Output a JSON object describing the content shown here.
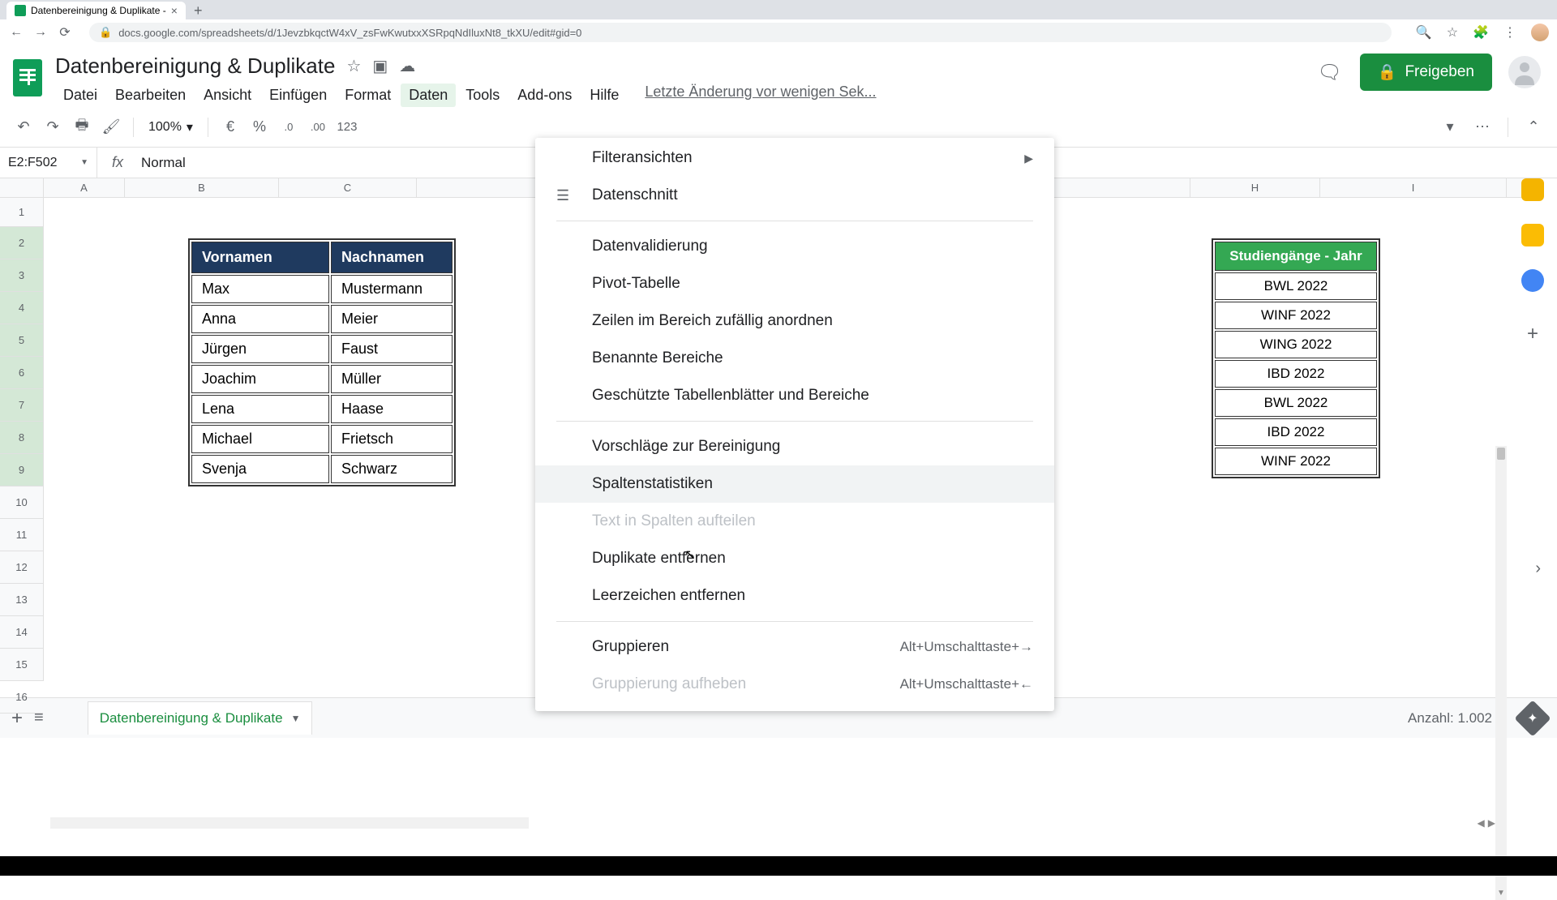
{
  "browser": {
    "tab_title": "Datenbereinigung & Duplikate -",
    "url": "docs.google.com/spreadsheets/d/1JevzbkqctW4xV_zsFwKwutxxXSRpqNdIluxNt8_tkXU/edit#gid=0"
  },
  "doc": {
    "title": "Datenbereinigung & Duplikate",
    "last_edit": "Letzte Änderung vor wenigen Sek..."
  },
  "menu": {
    "file": "Datei",
    "edit": "Bearbeiten",
    "view": "Ansicht",
    "insert": "Einfügen",
    "format": "Format",
    "data": "Daten",
    "tools": "Tools",
    "addons": "Add-ons",
    "help": "Hilfe"
  },
  "toolbar": {
    "zoom": "100%",
    "currency": "€",
    "percent": "%",
    "dec_less": ".0",
    "dec_more": ".00",
    "format123": "123"
  },
  "share_label": "Freigeben",
  "namebox": "E2:F502",
  "formula_value": "Normal",
  "col_headers": [
    "A",
    "B",
    "C",
    "H",
    "I"
  ],
  "row_numbers": [
    "1",
    "2",
    "3",
    "4",
    "5",
    "6",
    "7",
    "8",
    "9",
    "10",
    "11",
    "12",
    "13",
    "14",
    "15",
    "16"
  ],
  "table1": {
    "headers": [
      "Vornamen",
      "Nachnamen"
    ],
    "rows": [
      [
        "Max",
        "Mustermann"
      ],
      [
        "Anna",
        "Meier"
      ],
      [
        "Jürgen",
        "Faust"
      ],
      [
        "Joachim",
        "Müller"
      ],
      [
        "Lena",
        "Haase"
      ],
      [
        "Michael",
        "Frietsch"
      ],
      [
        "Svenja",
        "Schwarz"
      ]
    ]
  },
  "table2": {
    "header": "Studiengänge - Jahr",
    "rows": [
      "BWL 2022",
      "WINF 2022",
      "WING 2022",
      "IBD 2022",
      "BWL 2022",
      "IBD 2022",
      "WINF 2022"
    ]
  },
  "dropdown": {
    "filter_views": "Filteransichten",
    "slicer": "Datenschnitt",
    "validation": "Datenvalidierung",
    "pivot": "Pivot-Tabelle",
    "randomize": "Zeilen im Bereich zufällig anordnen",
    "named_ranges": "Benannte Bereiche",
    "protected": "Geschützte Tabellenblätter und Bereiche",
    "cleanup_suggestions": "Vorschläge zur Bereinigung",
    "column_stats": "Spaltenstatistiken",
    "split_text": "Text in Spalten aufteilen",
    "remove_duplicates": "Duplikate entfernen",
    "trim_whitespace": "Leerzeichen entfernen",
    "group": "Gruppieren",
    "group_sc": "Alt+Umschalttaste+→",
    "ungroup": "Gruppierung aufheben",
    "ungroup_sc": "Alt+Umschalttaste+←"
  },
  "sheet_tab": "Datenbereinigung & Duplikate",
  "count_label": "Anzahl: 1.002"
}
